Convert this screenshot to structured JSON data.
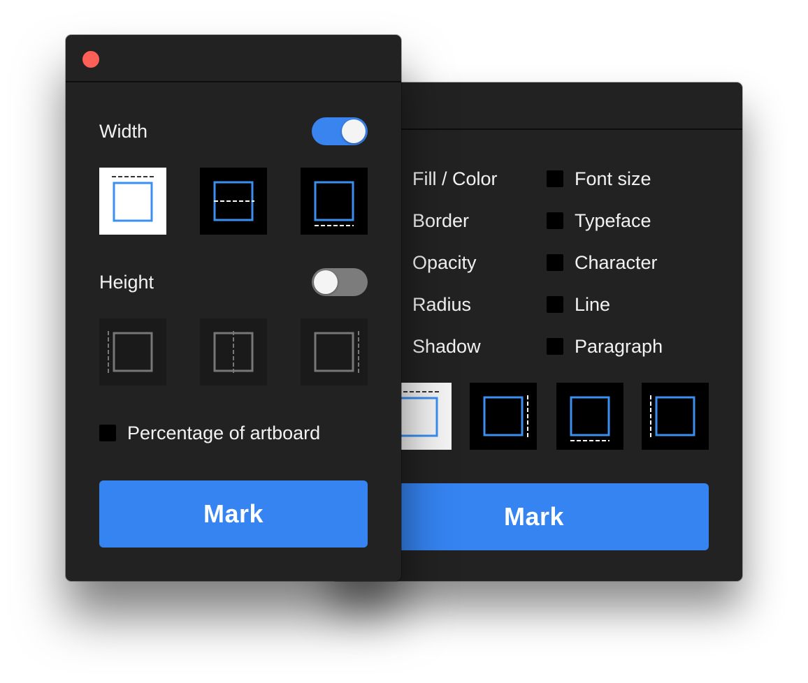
{
  "front_panel": {
    "width_label": "Width",
    "width_toggle_on": true,
    "height_label": "Height",
    "height_toggle_on": false,
    "percentage_label": "Percentage of artboard",
    "mark_label": "Mark"
  },
  "back_panel": {
    "properties_left": [
      "Fill / Color",
      "Border",
      "Opacity",
      "Radius",
      "Shadow"
    ],
    "properties_right": [
      "Font size",
      "Typeface",
      "Character",
      "Line",
      "Paragraph"
    ],
    "mark_label": "Mark"
  },
  "colors": {
    "panel_bg": "#222222",
    "accent_blue": "#3584f2",
    "close_red": "#fe5f57",
    "toggle_off": "#7c7c7c"
  }
}
